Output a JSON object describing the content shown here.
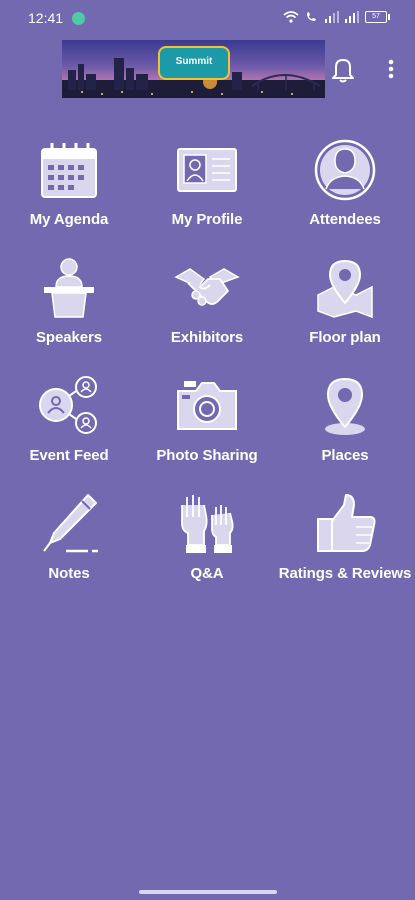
{
  "status": {
    "time": "12:41",
    "battery": "57"
  },
  "colors": {
    "background": "#7369b1",
    "icon_fill": "#d9d6ee",
    "icon_stroke": "#ffffff"
  },
  "header": {
    "banner_logo_text": "Summit",
    "bell_icon": "bell-icon",
    "menu_icon": "more-vert-icon"
  },
  "tiles": [
    {
      "label": "My Agenda",
      "icon": "calendar-icon"
    },
    {
      "label": "My Profile",
      "icon": "id-card-icon"
    },
    {
      "label": "Attendees",
      "icon": "person-circle-icon"
    },
    {
      "label": "Speakers",
      "icon": "podium-speaker-icon"
    },
    {
      "label": "Exhibitors",
      "icon": "handshake-icon"
    },
    {
      "label": "Floor plan",
      "icon": "map-pin-icon"
    },
    {
      "label": "Event Feed",
      "icon": "network-people-icon"
    },
    {
      "label": "Photo Sharing",
      "icon": "camera-icon"
    },
    {
      "label": "Places",
      "icon": "location-pin-icon"
    },
    {
      "label": "Notes",
      "icon": "pen-icon"
    },
    {
      "label": "Q&A",
      "icon": "raised-hands-icon"
    },
    {
      "label": "Ratings & Reviews",
      "icon": "thumbs-up-icon"
    }
  ]
}
